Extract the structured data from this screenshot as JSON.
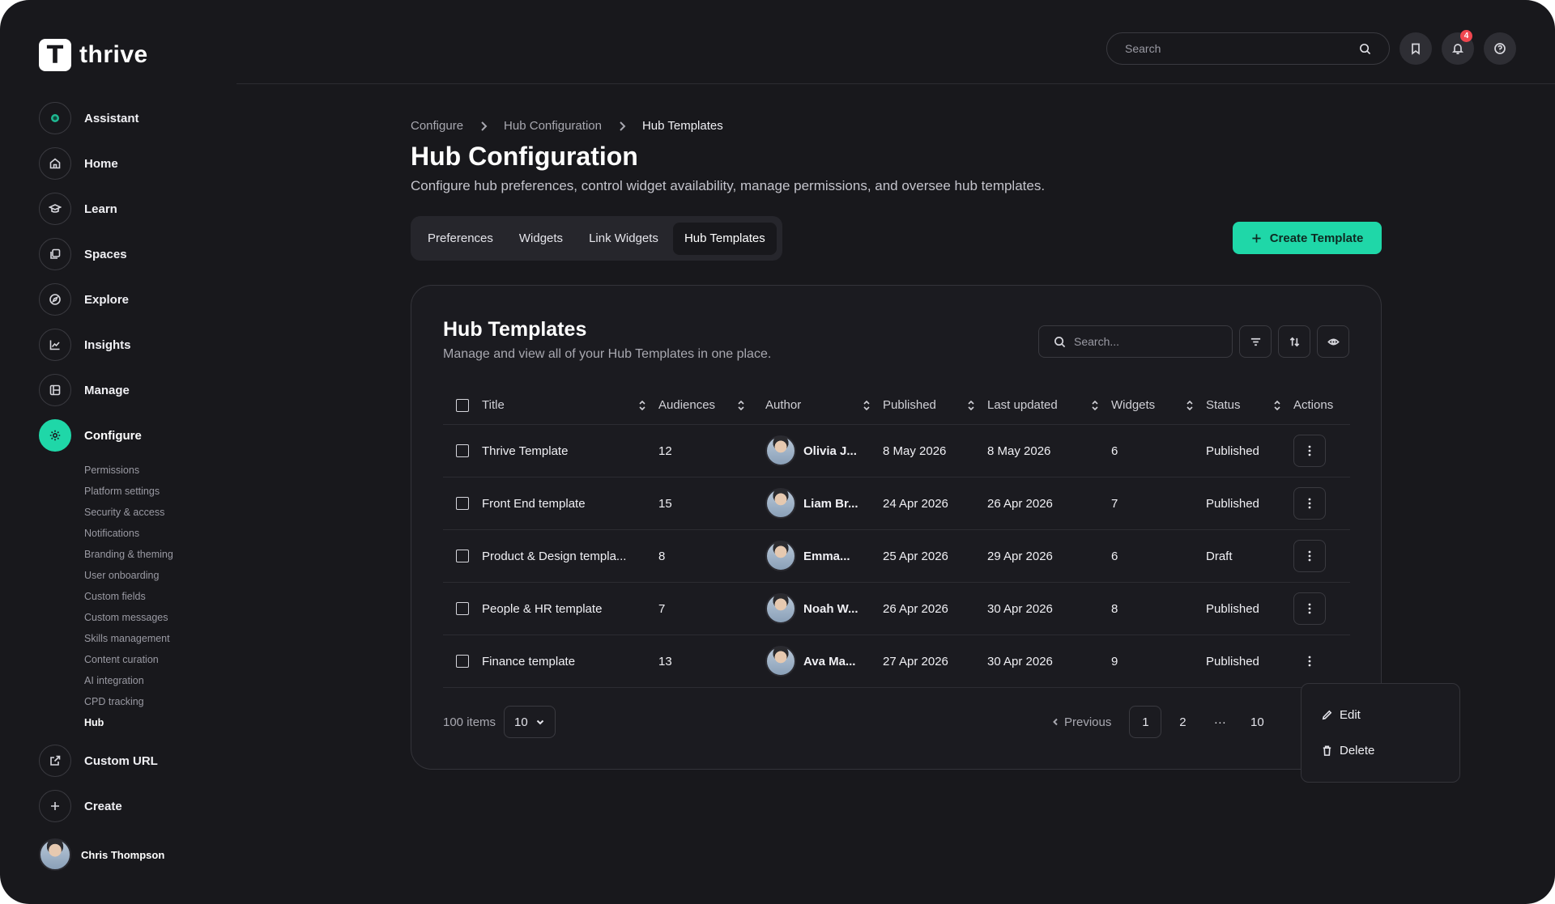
{
  "app": {
    "logo_letter": "T",
    "name": "thrive"
  },
  "sidebar": {
    "items": [
      {
        "label": "Assistant",
        "icon": "assistant-dot-icon"
      },
      {
        "label": "Home",
        "icon": "home-icon"
      },
      {
        "label": "Learn",
        "icon": "graduation-cap-icon"
      },
      {
        "label": "Spaces",
        "icon": "spaces-icon"
      },
      {
        "label": "Explore",
        "icon": "compass-icon"
      },
      {
        "label": "Insights",
        "icon": "chart-icon"
      },
      {
        "label": "Manage",
        "icon": "manage-icon"
      },
      {
        "label": "Configure",
        "icon": "gear-icon"
      }
    ],
    "sub_items": [
      "Permissions",
      "Platform settings",
      "Security & access",
      "Notifications",
      "Branding & theming",
      "User onboarding",
      "Custom fields",
      "Custom messages",
      "Skills management",
      "Content curation",
      "AI integration",
      "CPD tracking",
      "Hub"
    ],
    "bottom_items": [
      {
        "label": "Custom URL",
        "icon": "external-link-icon"
      },
      {
        "label": "Create",
        "icon": "plus-icon"
      }
    ],
    "user_name": "Chris Thompson"
  },
  "header": {
    "search_placeholder": "Search",
    "notification_count": "4"
  },
  "breadcrumb": [
    "Configure",
    "Hub Configuration",
    "Hub Templates"
  ],
  "page": {
    "title": "Hub Configuration",
    "subtitle": "Configure hub preferences, control widget availability, manage permissions, and oversee hub templates."
  },
  "tabs": [
    "Preferences",
    "Widgets",
    "Link Widgets",
    "Hub Templates"
  ],
  "create_button_label": "Create Template",
  "card": {
    "title": "Hub Templates",
    "subtitle": "Manage and view all of your Hub Templates in one place.",
    "search_placeholder": "Search..."
  },
  "table": {
    "columns": [
      "Title",
      "Audiences",
      "Author",
      "Published",
      "Last updated",
      "Widgets",
      "Status",
      "Actions"
    ],
    "rows": [
      {
        "title": "Thrive Template",
        "audiences": "12",
        "author": "Olivia J...",
        "published": "8 May 2026",
        "updated": "8 May 2026",
        "widgets": "6",
        "status": "Published"
      },
      {
        "title": "Front End template",
        "audiences": "15",
        "author": "Liam Br...",
        "published": "24 Apr 2026",
        "updated": "26 Apr 2026",
        "widgets": "7",
        "status": "Published"
      },
      {
        "title": "Product & Design templa...",
        "audiences": "8",
        "author": "Emma...",
        "published": "25 Apr 2026",
        "updated": "29 Apr 2026",
        "widgets": "6",
        "status": "Draft"
      },
      {
        "title": "People & HR template",
        "audiences": "7",
        "author": "Noah W...",
        "published": "26 Apr 2026",
        "updated": "30 Apr 2026",
        "widgets": "8",
        "status": "Published"
      },
      {
        "title": "Finance template",
        "audiences": "13",
        "author": "Ava Ma...",
        "published": "27 Apr 2026",
        "updated": "30 Apr 2026",
        "widgets": "9",
        "status": "Published"
      }
    ]
  },
  "pagination": {
    "total_label": "100 items",
    "page_size": "10",
    "previous_label": "Previous",
    "pages": [
      "1",
      "2",
      "···",
      "10"
    ],
    "current_page": "1"
  },
  "context_menu": {
    "edit_label": "Edit",
    "delete_label": "Delete"
  },
  "colors": {
    "accent": "#1fd7a8",
    "background": "#18181c",
    "badge": "#f0464f"
  }
}
